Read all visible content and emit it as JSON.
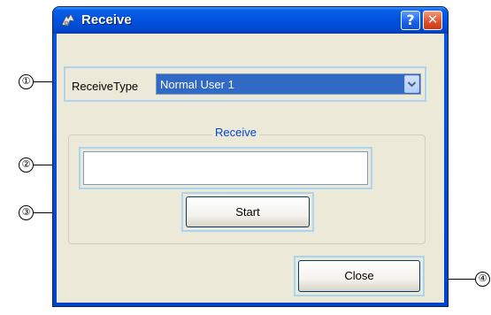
{
  "window": {
    "title": "Receive",
    "help_glyph": "?",
    "close_glyph": "✕"
  },
  "receive_type": {
    "label": "ReceiveType",
    "selected": "Normal User 1"
  },
  "receive_group": {
    "label": "Receive",
    "field_value": ""
  },
  "buttons": {
    "start": "Start",
    "close": "Close"
  },
  "callouts": [
    "①",
    "②",
    "③",
    "④"
  ],
  "colors": {
    "titlebar": "#0052de",
    "client_bg": "#ece9d8",
    "selection": "#316ac5",
    "group_label": "#0046d5",
    "highlight": "#a9d6ee"
  }
}
